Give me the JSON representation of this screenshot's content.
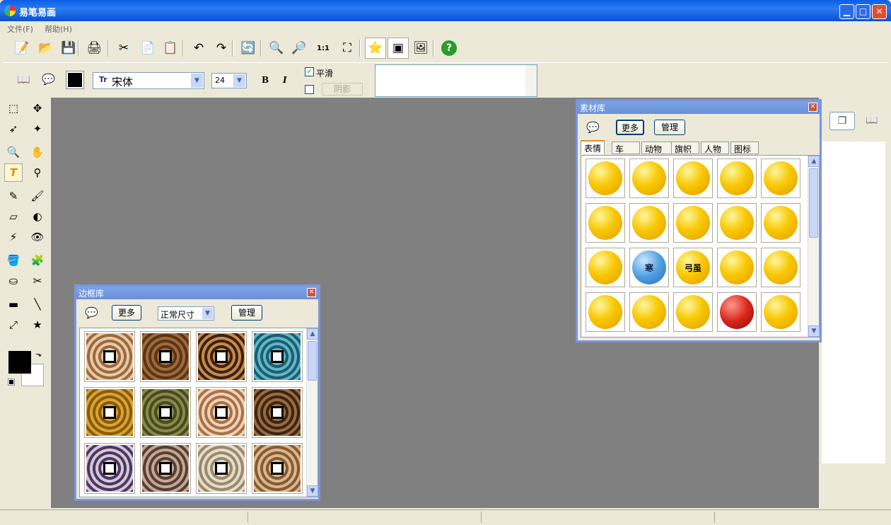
{
  "window": {
    "title": "易笔易画",
    "min": "▁",
    "max": "□",
    "close": "✕"
  },
  "menu": [
    {
      "label": "文件(F)"
    },
    {
      "label": "帮助(H)"
    }
  ],
  "toolbar1": [
    {
      "name": "new-icon",
      "glyph": "📝"
    },
    {
      "name": "open-folder-icon",
      "glyph": "📂"
    },
    {
      "name": "save-icon",
      "glyph": "💾"
    },
    {
      "name": "print-icon",
      "glyph": "🖨"
    },
    {
      "name": "cut-icon",
      "glyph": "✂"
    },
    {
      "name": "copy-icon",
      "glyph": "📄"
    },
    {
      "name": "paste-icon",
      "glyph": "📋"
    },
    {
      "name": "undo-icon",
      "glyph": "↶"
    },
    {
      "name": "redo-icon",
      "glyph": "↷"
    },
    {
      "name": "refresh-icon",
      "glyph": "🔄"
    },
    {
      "name": "zoom-in-icon",
      "glyph": "🔍"
    },
    {
      "name": "zoom-out-icon",
      "glyph": "🔎"
    },
    {
      "name": "actual-size-icon",
      "glyph": "1:1"
    },
    {
      "name": "fit-screen-icon",
      "glyph": "⛶"
    },
    {
      "name": "clipart-icon",
      "glyph": "⭐"
    },
    {
      "name": "frame-icon",
      "glyph": "▣"
    },
    {
      "name": "image-icon",
      "glyph": "🖼"
    },
    {
      "name": "help-icon",
      "glyph": "?"
    }
  ],
  "toolbar2": {
    "book_icon": "📖",
    "comment_icon": "💬",
    "font_icon": "Tr",
    "font": "宋体",
    "size": "24",
    "bold": "B",
    "italic": "I",
    "smooth_label": "平滑",
    "shadow_label": "阴影",
    "check_mark": "✓"
  },
  "leftTools": [
    {
      "name": "rect-select-icon",
      "glyph": "⬚"
    },
    {
      "name": "move-icon",
      "glyph": "✥"
    },
    {
      "name": "lasso-icon",
      "glyph": "➶"
    },
    {
      "name": "magic-wand-icon",
      "glyph": "✦"
    },
    {
      "name": "zoom-tool-icon",
      "glyph": "🔍"
    },
    {
      "name": "hand-icon",
      "glyph": "✋"
    },
    {
      "name": "text-tool-icon",
      "glyph": "T"
    },
    {
      "name": "eyedropper-icon",
      "glyph": "⚲"
    },
    {
      "name": "pencil-icon",
      "glyph": "✎"
    },
    {
      "name": "brush-icon",
      "glyph": "🖌"
    },
    {
      "name": "eraser-icon",
      "glyph": "▱"
    },
    {
      "name": "contrast-icon",
      "glyph": "◐"
    },
    {
      "name": "fill-icon",
      "glyph": "⚡"
    },
    {
      "name": "red-eye-icon",
      "glyph": "👁"
    },
    {
      "name": "bucket-icon",
      "glyph": "🪣"
    },
    {
      "name": "puzzle-icon",
      "glyph": "🧩"
    },
    {
      "name": "stamp-icon",
      "glyph": "⛀"
    },
    {
      "name": "scissors-icon",
      "glyph": "✂"
    },
    {
      "name": "gradient-icon",
      "glyph": "▬"
    },
    {
      "name": "line-icon",
      "glyph": "╲"
    },
    {
      "name": "transform-icon",
      "glyph": "⤢"
    },
    {
      "name": "star-shape-icon",
      "glyph": "★"
    }
  ],
  "swap_icon": "⬎",
  "right_icons": {
    "cascade": "❐",
    "book": "📖"
  },
  "material": {
    "title": "素材库",
    "close": "✕",
    "more": "更多",
    "manage": "管理",
    "tabs": [
      "表情",
      "车",
      "动物",
      "旗帜",
      "人物",
      "图标"
    ],
    "emoji_labels": [
      "寒",
      "弓虽"
    ],
    "scroll_up": "▲",
    "scroll_down": "▼"
  },
  "frames": {
    "title": "边框库",
    "close": "✕",
    "more": "更多",
    "size_select": "正常尺寸",
    "manage": "管理",
    "scroll_up": "▲",
    "scroll_down": "▼"
  },
  "colors": {
    "foreground": "#000000",
    "background": "#ffffff",
    "canvas": "#808080"
  }
}
